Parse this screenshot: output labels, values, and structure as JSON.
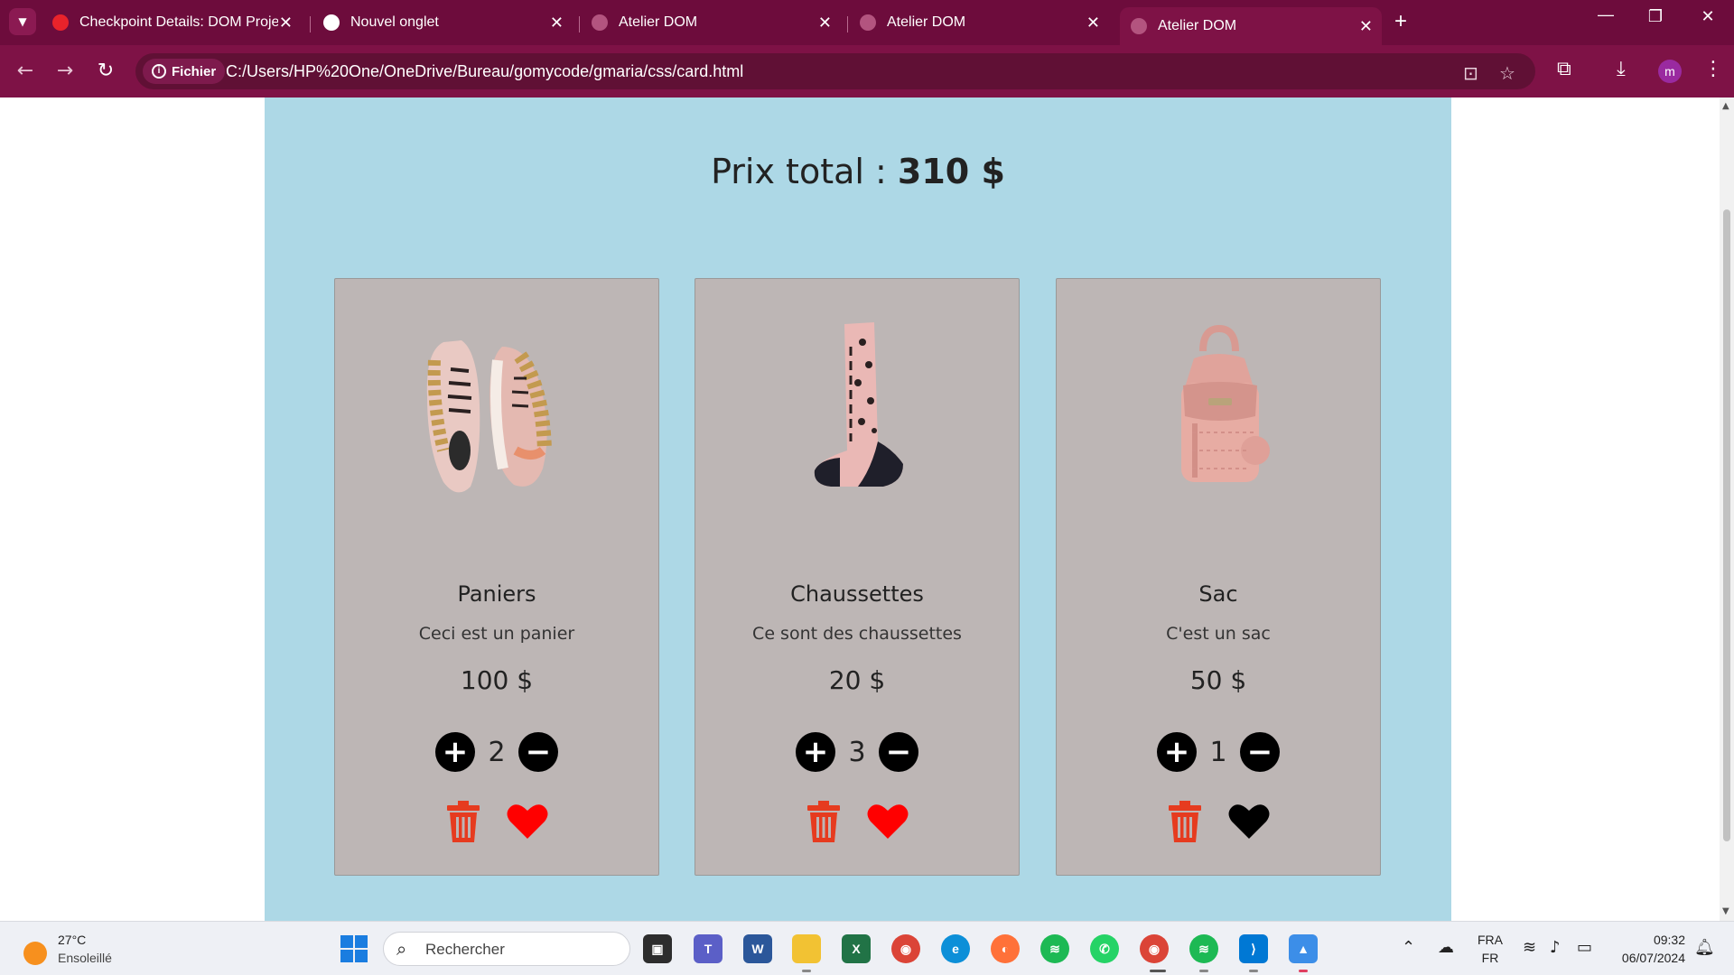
{
  "browser": {
    "tabs": [
      {
        "title": "Checkpoint Details: DOM Proje",
        "active": false,
        "favicon_color": "#e8232b"
      },
      {
        "title": "Nouvel onglet",
        "active": false,
        "favicon_color": "#ffffff"
      },
      {
        "title": "Atelier DOM",
        "active": false,
        "favicon_color": "#b3547f"
      },
      {
        "title": "Atelier DOM",
        "active": false,
        "favicon_color": "#b3547f"
      },
      {
        "title": "Atelier DOM",
        "active": true,
        "favicon_color": "#b3547f"
      }
    ],
    "address_chip": "Fichier",
    "url": "C:/Users/HP%20One/OneDrive/Bureau/gomycode/gmaria/css/card.html",
    "profile_initial": "m"
  },
  "page": {
    "total_label": "Prix total : ",
    "total_value": "310 $",
    "cards": [
      {
        "name": "Paniers",
        "description": "Ceci est un panier",
        "price": "100 $",
        "quantity": "2",
        "liked": true
      },
      {
        "name": "Chaussettes",
        "description": "Ce sont des chaussettes",
        "price": "20 $",
        "quantity": "3",
        "liked": true
      },
      {
        "name": "Sac",
        "description": "C'est un sac",
        "price": "50 $",
        "quantity": "1",
        "liked": false
      }
    ]
  },
  "taskbar": {
    "weather_temp": "27°C",
    "weather_desc": "Ensoleillé",
    "search_placeholder": "Rechercher",
    "lang_top": "FRA",
    "lang_bottom": "FR",
    "time": "09:32",
    "date": "06/07/2024"
  },
  "colors": {
    "browser_frame": "#7e1246",
    "page_background": "#add8e6",
    "card_background": "#bdb6b5",
    "trash": "#e63b1f",
    "heart_liked": "#ff0000",
    "heart_unliked": "#000000"
  }
}
